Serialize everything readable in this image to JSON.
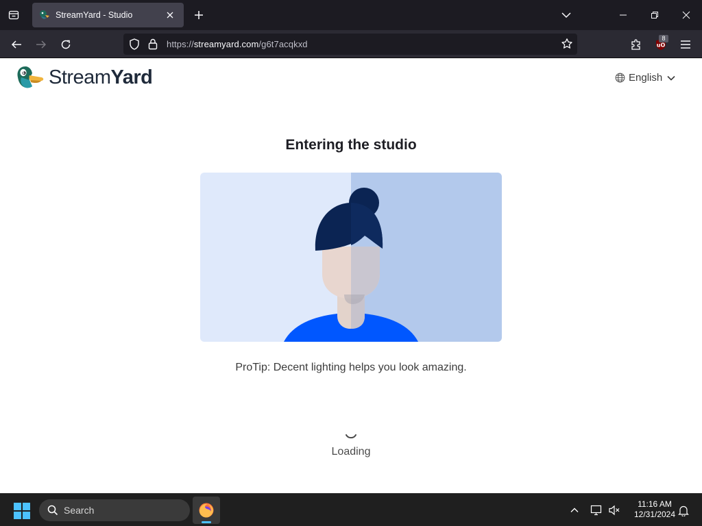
{
  "browser": {
    "tab_title": "StreamYard - Studio",
    "url_prefix": "https://",
    "url_host": "streamyard.com",
    "url_path": "/g6t7acqkxd",
    "extension_badge": "8"
  },
  "page": {
    "brand_regular": "Stream",
    "brand_bold": "Yard",
    "language": "English",
    "heading": "Entering the studio",
    "protip": "ProTip: Decent lighting helps you look amazing.",
    "loading": "Loading"
  },
  "taskbar": {
    "search_placeholder": "Search",
    "time": "11:16 AM",
    "date": "12/31/2024"
  },
  "colors": {
    "accent_blue": "#0057ff",
    "illustration_left": "#dfe9fb",
    "illustration_right": "#b3c9ec",
    "hair": "#0b2453"
  }
}
